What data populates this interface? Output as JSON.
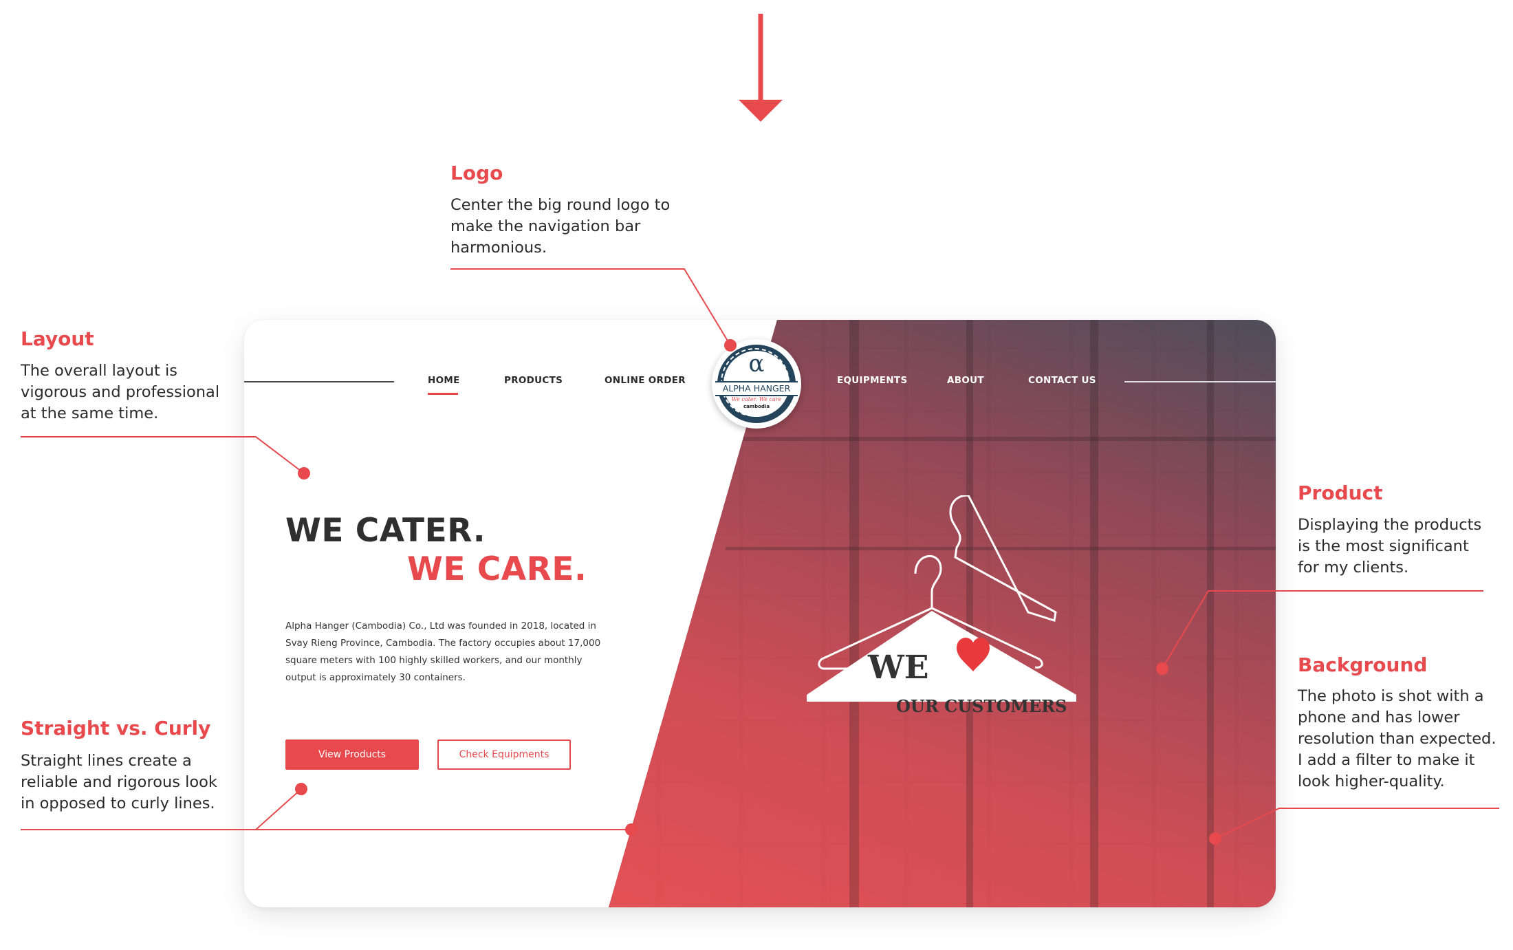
{
  "annotations": {
    "logo": {
      "title": "Logo",
      "lines": [
        "Center the big round logo to",
        "make the navigation bar",
        "harmonious."
      ]
    },
    "layout": {
      "title": "Layout",
      "lines": [
        "The overall layout is",
        "vigorous and professional",
        "at the same time."
      ]
    },
    "product": {
      "title": "Product",
      "lines": [
        "Displaying the products",
        "is the most significant",
        "for my clients."
      ]
    },
    "background": {
      "title": "Background",
      "lines": [
        "The photo is shot with a",
        "phone and has lower",
        "resolution than expected.",
        "I add a filter to make it",
        "look higher-quality."
      ]
    },
    "straight": {
      "title": "Straight vs. Curly",
      "lines": [
        "Straight lines create a",
        "reliable and rigorous look",
        "in opposed to curly lines."
      ]
    }
  },
  "nav": {
    "left": [
      "HOME",
      "PRODUCTS",
      "ONLINE ORDER"
    ],
    "right": [
      "EQUIPMENTS",
      "ABOUT",
      "CONTACT US"
    ],
    "active": "HOME"
  },
  "logo": {
    "symbol": "α",
    "name": "ALPHA HANGER",
    "tagline": "We cater. We care",
    "region": "cambodia"
  },
  "hero": {
    "line1": "WE CATER.",
    "line2": "WE CARE.",
    "intro_lines": [
      "Alpha Hanger (Cambodia) Co., Ltd was founded in 2018, located in",
      "Svay Rieng Province, Cambodia. The factory occupies about 17,000",
      "square meters with 100 highly skilled workers, and our monthly",
      "output is approximately 30 containers."
    ],
    "primary_button": "View Products",
    "secondary_button": "Check Equipments"
  },
  "hanger_sign": {
    "word": "WE",
    "line2": "OUR CUSTOMERS",
    "heart_icon": "heart-icon"
  },
  "colors": {
    "accent": "#e8494d",
    "navy": "#24445c",
    "text": "#2f2f2f"
  }
}
